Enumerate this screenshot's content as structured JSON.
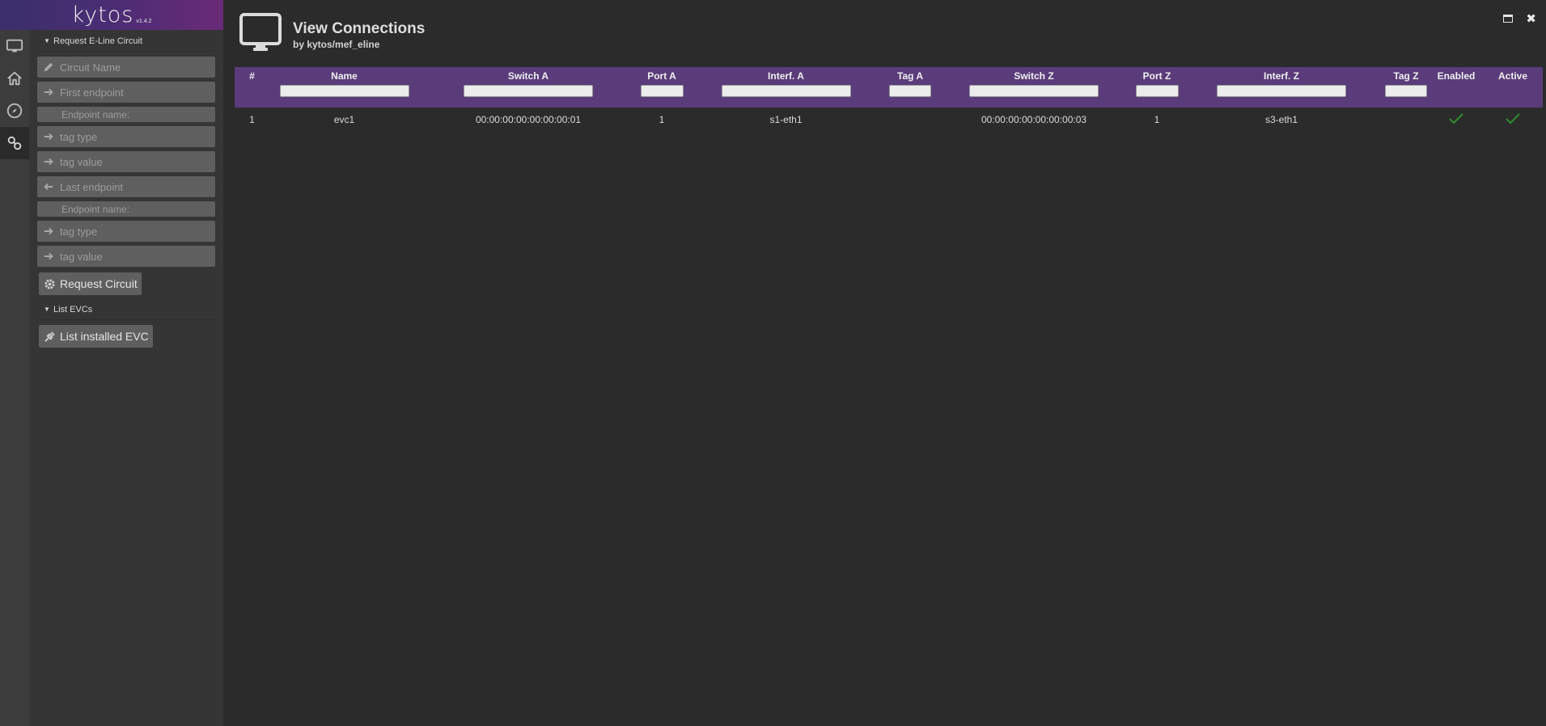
{
  "brand": {
    "name": "kytos",
    "version": "v1.4.2"
  },
  "rail": [
    {
      "icon": "monitor-icon"
    },
    {
      "icon": "home-icon"
    },
    {
      "icon": "compass-icon"
    },
    {
      "icon": "link-icon"
    }
  ],
  "panel": {
    "section1_title": "Request E-Line Circuit",
    "circuit_name_placeholder": "Circuit Name",
    "first_endpoint_placeholder": "First endpoint",
    "endpoint_name_label_a": "Endpoint name:",
    "tag_type_a_placeholder": "tag type",
    "tag_value_a_placeholder": "tag value",
    "last_endpoint_placeholder": "Last endpoint",
    "endpoint_name_label_z": "Endpoint name:",
    "tag_type_z_placeholder": "tag type",
    "tag_value_z_placeholder": "tag value",
    "request_button": "Request Circuit",
    "section2_title": "List EVCs",
    "list_button": "List installed EVC"
  },
  "main": {
    "title": "View Connections",
    "subtitle": "by kytos/mef_eline"
  },
  "table": {
    "headers": [
      "#",
      "Name",
      "Switch A",
      "Port A",
      "Interf. A",
      "Tag A",
      "Switch Z",
      "Port Z",
      "Interf. Z",
      "Tag Z",
      "Enabled",
      "Active"
    ],
    "rows": [
      {
        "num": "1",
        "name": "evc1",
        "switch_a": "00:00:00:00:00:00:00:01",
        "port_a": "1",
        "interf_a": "s1-eth1",
        "tag_a": "",
        "switch_z": "00:00:00:00:00:00:00:03",
        "port_z": "1",
        "interf_z": "s3-eth1",
        "tag_z": "",
        "enabled": true,
        "active": true
      }
    ]
  },
  "colors": {
    "header_purple": "#5a3c7a",
    "check_green": "#2f8f2f"
  }
}
